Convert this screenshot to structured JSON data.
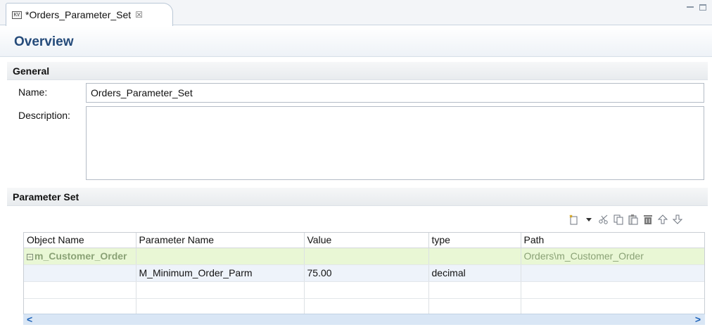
{
  "tab": {
    "label": "*Orders_Parameter_Set",
    "close_glyph": "☒",
    "icon_text": "KV"
  },
  "overview": {
    "title": "Overview"
  },
  "general": {
    "title": "General",
    "name_label": "Name:",
    "name_value": "Orders_Parameter_Set",
    "description_label": "Description:",
    "description_value": ""
  },
  "parameter_set": {
    "title": "Parameter Set",
    "toolbar": [
      "new-icon",
      "dropdown-arrow-icon",
      "cut-icon",
      "copy-icon",
      "paste-icon",
      "delete-icon",
      "move-up-icon",
      "move-down-icon"
    ],
    "columns": [
      "Object Name",
      "Parameter Name",
      "Value",
      "type",
      "Path"
    ],
    "rows": [
      {
        "object": "m_Customer_Order",
        "parameter": "",
        "value": "",
        "type": "",
        "path": "Orders\\m_Customer_Order"
      },
      {
        "object": "",
        "parameter": "M_Minimum_Order_Parm",
        "value": "75.00",
        "type": "decimal",
        "path": ""
      }
    ]
  },
  "colors": {
    "accent": "#254b7a",
    "group_row": "#e9f7d5",
    "group_text": "#8aa276",
    "scroll_arrow": "#1c62b8"
  }
}
